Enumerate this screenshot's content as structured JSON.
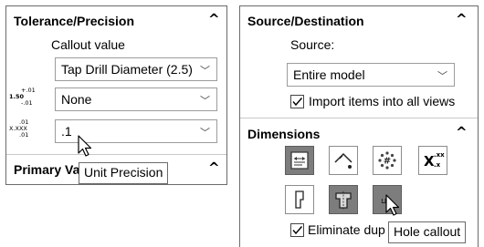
{
  "left_panel": {
    "tolerance_header": "Tolerance/Precision",
    "callout_label": "Callout value",
    "callout_select_value": "Tap Drill Diameter (2.5)",
    "tolerance_select_value": "None",
    "precision_select_value": ".1",
    "tol_icon_top": "+.01",
    "tol_icon_mid": "1.50",
    "tol_icon_bot": "-.01",
    "prec_icon_top": ".01",
    "prec_icon_mid": "X.XXX",
    "prec_icon_bot": ".01",
    "primary_header_partial": "Primary Va",
    "tooltip": "Unit Precision"
  },
  "right_panel": {
    "source_header": "Source/Destination",
    "source_label": "Source:",
    "source_select_value": "Entire model",
    "import_checkbox_label": "Import items into all views",
    "import_checked": true,
    "dimensions_header": "Dimensions",
    "xx_icon_main": "X",
    "xx_icon_sup": ".xx",
    "xx_icon_sub": ".x",
    "eliminate_label_partial": "Eliminate dup",
    "eliminate_checked": true,
    "tooltip": "Hole callout"
  },
  "icons": {
    "collapse": "chevron-up-icon",
    "dropdown": "chevron-down-icon"
  },
  "colors": {
    "active_button": "#7d7d7d",
    "border": "#6b6b6b"
  }
}
